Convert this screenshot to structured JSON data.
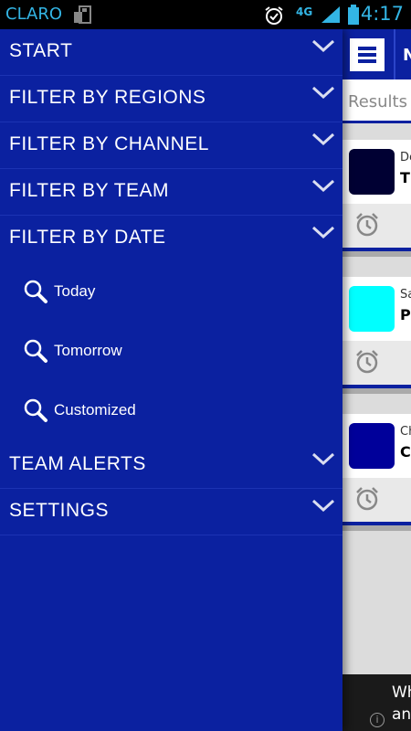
{
  "status_bar": {
    "carrier": "CLARO",
    "network": "4G",
    "time": "4:17"
  },
  "drawer": {
    "menu": [
      {
        "label": "START"
      },
      {
        "label": "FILTER BY REGIONS"
      },
      {
        "label": "FILTER BY CHANNEL"
      },
      {
        "label": "FILTER BY TEAM"
      },
      {
        "label": "FILTER BY DATE"
      }
    ],
    "date_options": [
      {
        "label": "Today"
      },
      {
        "label": "Tomorrow"
      },
      {
        "label": "Customized"
      }
    ],
    "menu_bottom": [
      {
        "label": "TEAM ALERTS"
      },
      {
        "label": "SETTINGS"
      }
    ]
  },
  "app": {
    "header_letter": "N",
    "results_label": "Results",
    "cards": [
      {
        "line1": "De",
        "line2": "Ti",
        "color": "#000033"
      },
      {
        "line1": "Sa",
        "line2": "P",
        "color": "#00ffff"
      },
      {
        "line1": "Ch",
        "line2": "C",
        "color": "#00009a"
      }
    ],
    "ad_text_1": "Wh",
    "ad_text_2": "an",
    "ad_info": "i"
  },
  "colors": {
    "drawer_bg": "#0b21a0",
    "status_text": "#33b5e5"
  }
}
